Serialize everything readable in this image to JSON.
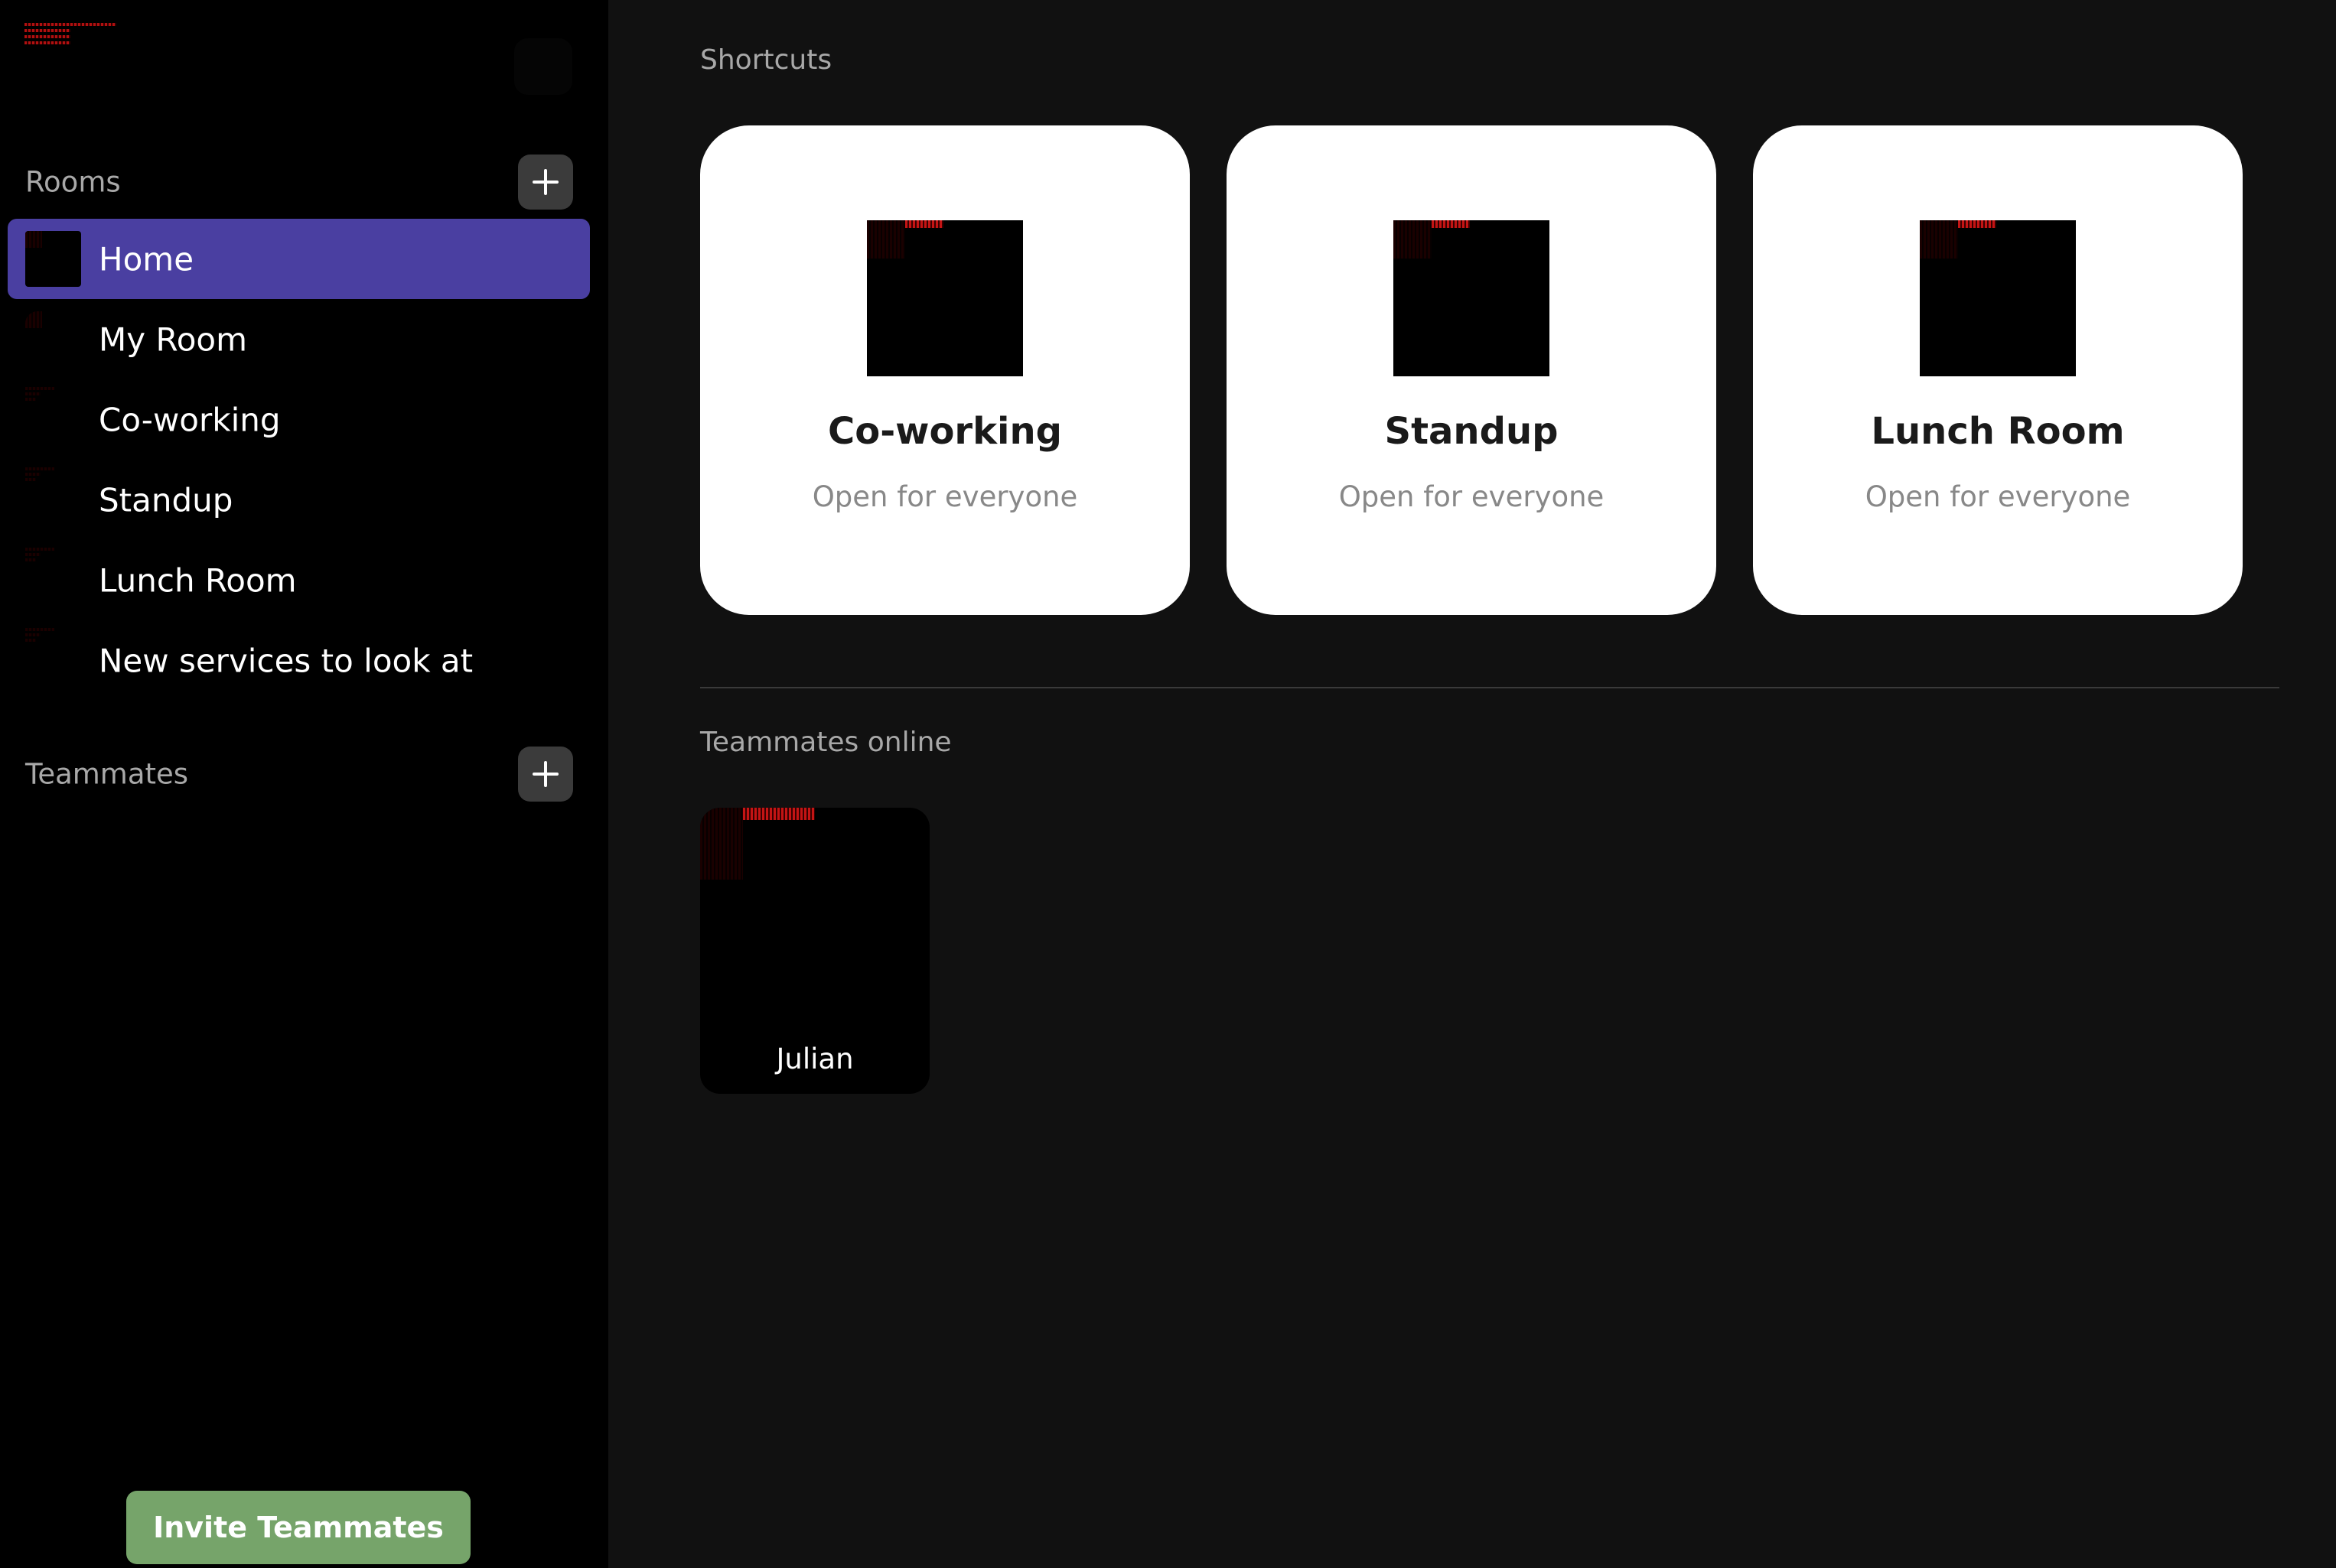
{
  "sidebar": {
    "rooms_title": "Rooms",
    "teammates_title": "Teammates",
    "rooms": [
      {
        "label": "Home",
        "active": true
      },
      {
        "label": "My Room",
        "active": false
      },
      {
        "label": "Co-working",
        "active": false
      },
      {
        "label": "Standup",
        "active": false
      },
      {
        "label": "Lunch Room",
        "active": false
      },
      {
        "label": "New services to look at",
        "active": false
      }
    ],
    "invite_label": "Invite Teammates"
  },
  "main": {
    "shortcuts_title": "Shortcuts",
    "shortcuts": [
      {
        "title": "Co-working",
        "subtitle": "Open for everyone"
      },
      {
        "title": "Standup",
        "subtitle": "Open for everyone"
      },
      {
        "title": "Lunch Room",
        "subtitle": "Open for everyone"
      }
    ],
    "teammates_online_title": "Teammates online",
    "teammates_online": [
      {
        "name": "Julian"
      }
    ]
  },
  "colors": {
    "sidebar_bg": "#000000",
    "main_bg": "#111111",
    "active_room": "#4a3fa1",
    "invite_button": "#76a46a",
    "card_bg": "#ffffff"
  },
  "icons": {
    "add_room": "plus-icon",
    "add_teammate": "plus-icon"
  }
}
